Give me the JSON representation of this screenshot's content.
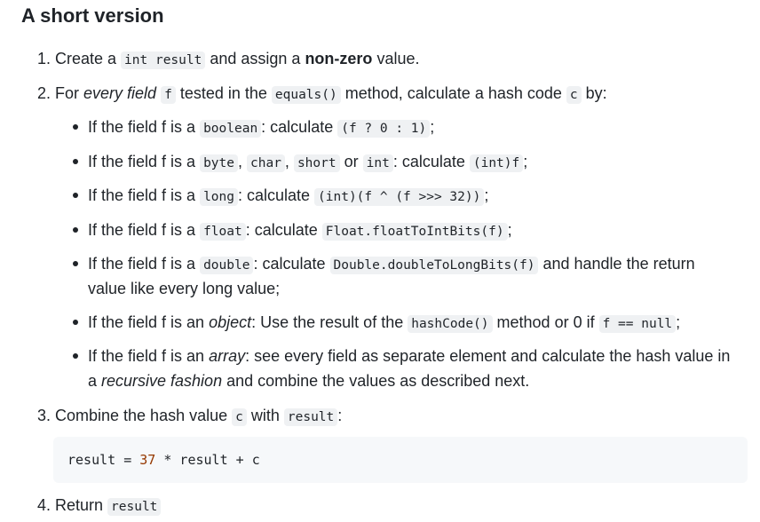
{
  "heading": "A short version",
  "step1": {
    "num": "1.",
    "pre": "Create a ",
    "code": "int result",
    "mid": " and assign a ",
    "bold": "non-zero",
    "post": " value."
  },
  "step2": {
    "num": "2.",
    "pre": "For ",
    "italic": "every field",
    "space": " ",
    "code1": "f",
    "mid": " tested in the ",
    "code2": "equals()",
    "mid2": " method, calculate a hash code ",
    "code3": "c",
    "post": " by:"
  },
  "bullets": {
    "b1": {
      "pre": "If the field f is a ",
      "code1": "boolean",
      "mid": ": calculate ",
      "code2": "(f ? 0 : 1)",
      "post": ";"
    },
    "b2": {
      "pre": "If the field f is a ",
      "code1": "byte",
      "sep1": ", ",
      "code2": "char",
      "sep2": ", ",
      "code3": "short",
      "sep3": " or ",
      "code4": "int",
      "mid": ": calculate ",
      "code5": "(int)f",
      "post": ";"
    },
    "b3": {
      "pre": "If the field f is a ",
      "code1": "long",
      "mid": ": calculate ",
      "code2": "(int)(f ^ (f >>> 32))",
      "post": ";"
    },
    "b4": {
      "pre": "If the field f is a ",
      "code1": "float",
      "mid": ": calculate ",
      "code2": "Float.floatToIntBits(f)",
      "post": ";"
    },
    "b5": {
      "pre": "If the field f is a ",
      "code1": "double",
      "mid": ": calculate ",
      "code2": "Double.doubleToLongBits(f)",
      "post": " and handle the return",
      "line2": "value like every long value;"
    },
    "b6": {
      "pre": "If the field f is an ",
      "italic": "object",
      "mid": ": Use the result of the ",
      "code1": "hashCode()",
      "mid2": " method or 0 if ",
      "code2": "f == null",
      "post": ";"
    },
    "b7": {
      "pre": "If the field f is an ",
      "italic": "array",
      "mid": ": see every field as separate element and calculate the hash value in",
      "line2_pre": "a ",
      "line2_italic": "recursive fashion",
      "line2_post": " and combine the values as described next."
    }
  },
  "step3": {
    "num": "3.",
    "pre": "Combine the hash value ",
    "code1": "c",
    "mid": " with ",
    "code2": "result",
    "post": ":"
  },
  "codeblock": {
    "t1": "result = ",
    "t2": "37",
    "t3": " * result + c"
  },
  "step4": {
    "num": "4.",
    "pre": "Return ",
    "code": "result"
  }
}
